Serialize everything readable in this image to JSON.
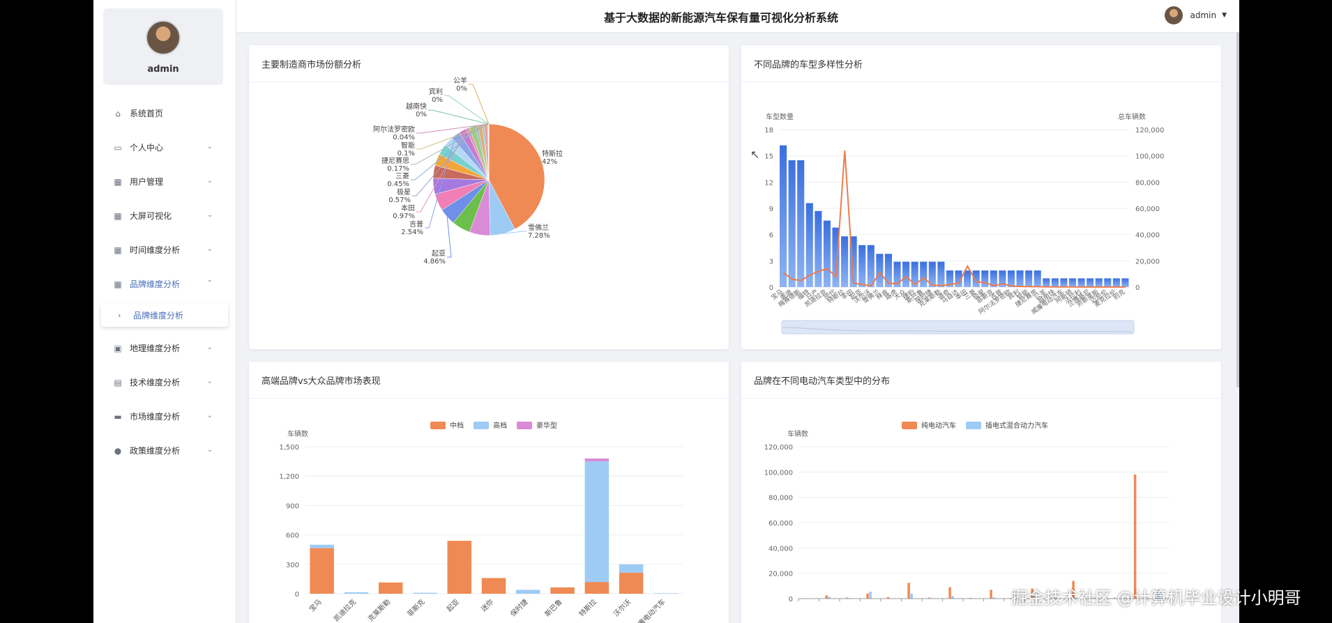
{
  "sidebar": {
    "username": "admin",
    "items": [
      {
        "label": "系统首页",
        "icon": "home-icon"
      },
      {
        "label": "个人中心",
        "icon": "id-card-icon"
      },
      {
        "label": "用户管理",
        "icon": "grid-icon"
      },
      {
        "label": "大屏可视化",
        "icon": "grid-icon"
      },
      {
        "label": "时间维度分析",
        "icon": "grid-icon"
      },
      {
        "label": "品牌维度分析",
        "icon": "grid-icon"
      },
      {
        "label": "地理维度分析",
        "icon": "bag-icon"
      },
      {
        "label": "技术维度分析",
        "icon": "clipboard-icon"
      },
      {
        "label": "市场维度分析",
        "icon": "monitor-icon"
      },
      {
        "label": "政策维度分析",
        "icon": "user-icon"
      }
    ],
    "active_sub": "品牌维度分析"
  },
  "header": {
    "title": "基于大数据的新能源汽车保有量可视化分析系统",
    "user": "admin"
  },
  "watermark": "掘金技术社区 @计算机毕业设计小明哥",
  "chart_data": [
    {
      "type": "pie",
      "title": "主要制造商市场份额分析",
      "slices": [
        {
          "name": "特斯拉",
          "label": "42%",
          "value": 42,
          "color": "#ef8a54"
        },
        {
          "name": "雪佛兰",
          "label": "7.28%",
          "value": 7.28,
          "color": "#9ecbf5"
        },
        {
          "name": "",
          "label": "",
          "value": 6.0,
          "color": "#d98bd6"
        },
        {
          "name": "",
          "label": "",
          "value": 5.3,
          "color": "#6bbf4a"
        },
        {
          "name": "起亚",
          "label": "4.86%",
          "value": 4.86,
          "color": "#6f8fe8"
        },
        {
          "name": "",
          "label": "",
          "value": 4.9,
          "color": "#ef7fb4"
        },
        {
          "name": "",
          "label": "",
          "value": 4.6,
          "color": "#a57ae0"
        },
        {
          "name": "",
          "label": "",
          "value": 3.7,
          "color": "#c96a5e"
        },
        {
          "name": "",
          "label": "",
          "value": 3.4,
          "color": "#f1a63c"
        },
        {
          "name": "",
          "label": "",
          "value": 3.1,
          "color": "#76d1d0"
        },
        {
          "name": "",
          "label": "",
          "value": 2.8,
          "color": "#b4d8f5"
        },
        {
          "name": "吉普",
          "label": "2.54%",
          "value": 2.54,
          "color": "#8aa4e8"
        },
        {
          "name": "",
          "label": "",
          "value": 2.2,
          "color": "#c67bcf"
        },
        {
          "name": "本田",
          "label": "0.97%",
          "value": 0.97,
          "color": "#e991b9"
        },
        {
          "name": "",
          "label": "",
          "value": 1.8,
          "color": "#9ad07f"
        },
        {
          "name": "极星",
          "label": "0.57%",
          "value": 0.57,
          "color": "#95a7c9"
        },
        {
          "name": "",
          "label": "",
          "value": 1.4,
          "color": "#d9b37a"
        },
        {
          "name": "三菱",
          "label": "0.45%",
          "value": 0.45,
          "color": "#7fb5d6"
        },
        {
          "name": "",
          "label": "",
          "value": 1.1,
          "color": "#e3a2a2"
        },
        {
          "name": "捷尼赛思",
          "label": "0.17%",
          "value": 0.17,
          "color": "#aab1bb"
        },
        {
          "name": "智能",
          "label": "0.1%",
          "value": 0.1,
          "color": "#cfc07a"
        },
        {
          "name": "阿尔法罗密欧",
          "label": "0.04%",
          "value": 0.04,
          "color": "#d18fb8"
        },
        {
          "name": "越南快",
          "label": "0%",
          "value": 0.01,
          "color": "#77c2a1"
        },
        {
          "name": "宾利",
          "label": "0%",
          "value": 0.01,
          "color": "#8fd0c8"
        },
        {
          "name": "公羊",
          "label": "0%",
          "value": 0.01,
          "color": "#dbb05a"
        }
      ]
    },
    {
      "type": "bar",
      "title": "不同品牌的车型多样性分析",
      "left_axis": {
        "label": "车型数量",
        "ticks": [
          "18",
          "15",
          "12",
          "9",
          "6",
          "3",
          "0"
        ],
        "max": 18
      },
      "right_axis": {
        "label": "总车辆数",
        "ticks": [
          "120,000",
          "100,000",
          "80,000",
          "60,000",
          "40,000",
          "20,000",
          "0"
        ],
        "max": 120000
      },
      "categories": [
        "宝马",
        "奥迪",
        "梅赛德斯",
        "福特",
        "日产",
        "凯迪拉克",
        "现代",
        "特斯拉",
        "丰田",
        "起亚",
        "沃尔沃",
        "雪佛兰",
        "林肯",
        "路虎",
        "大众",
        "捷豹",
        "斯巴鲁",
        "保时捷",
        "克莱斯勒",
        "道奇",
        "马自达",
        "本田",
        "三菱",
        "极星",
        "菲斯克",
        "吉普",
        "阿尔法罗密欧",
        "宾利",
        "智能",
        "捷尼赛思",
        "公羊",
        "越南快",
        "威廉电动汽车",
        "阿斯顿",
        "法拉利",
        "兰博基尼",
        "劳斯莱斯",
        "迈凯伦",
        "麦克拉伦",
        "别克"
      ],
      "series": [
        {
          "name": "车型数量",
          "values": [
            16.2,
            14.5,
            14.5,
            9.6,
            8.7,
            7.6,
            6.8,
            5.8,
            5.8,
            4.8,
            4.8,
            3.8,
            3.8,
            2.9,
            2.9,
            2.9,
            2.9,
            2.9,
            2.9,
            1.9,
            1.9,
            1.9,
            1.9,
            1.9,
            1.9,
            1.9,
            1.9,
            1.9,
            1.9,
            1.9,
            1.0,
            1.0,
            1.0,
            1.0,
            1.0,
            1.0,
            1.0,
            1.0,
            1.0,
            1.0
          ]
        },
        {
          "name": "总车辆数",
          "values": [
            11000,
            6000,
            5000,
            9000,
            12000,
            14000,
            8000,
            104000,
            3000,
            2000,
            1000,
            11000,
            3000,
            2500,
            8000,
            2000,
            7000,
            1500,
            1200,
            2000,
            3000,
            16000,
            4000,
            3500,
            1000,
            2500,
            800,
            500,
            400,
            300,
            200,
            150,
            120,
            100,
            90,
            80,
            70,
            60,
            50,
            40
          ]
        }
      ]
    },
    {
      "type": "bar",
      "title": "高端品牌vs大众品牌市场表现",
      "ylabel": "车辆数",
      "yticks": [
        "1,500",
        "1,200",
        "900",
        "600",
        "300",
        "0"
      ],
      "ymax": 1500,
      "categories": [
        "宝马",
        "凯迪拉克",
        "克莱斯勒",
        "菲斯克",
        "起亚",
        "迷你",
        "保时捷",
        "斯巴鲁",
        "特斯拉",
        "沃尔沃",
        "威廉电动汽车"
      ],
      "series": [
        {
          "name": "中档",
          "color": "#ef8a54",
          "values": [
            465,
            0,
            115,
            0,
            540,
            160,
            0,
            65,
            120,
            215,
            0
          ]
        },
        {
          "name": "高档",
          "color": "#9ecbf5",
          "values": [
            35,
            15,
            0,
            10,
            0,
            0,
            40,
            0,
            1230,
            85,
            5
          ]
        },
        {
          "name": "豪华型",
          "color": "#d98bd6",
          "values": [
            0,
            0,
            0,
            0,
            0,
            0,
            0,
            0,
            30,
            0,
            0
          ]
        }
      ]
    },
    {
      "type": "bar",
      "title": "品牌在不同电动汽车类型中的分布",
      "ylabel": "车辆数",
      "yticks": [
        "120,000",
        "100,000",
        "80,000",
        "60,000",
        "40,000",
        "20,000",
        "0"
      ],
      "ymax": 120000,
      "series": [
        {
          "name": "纯电动汽车",
          "color": "#ef8a54",
          "values": [
            300,
            2500,
            800,
            4000,
            1200,
            12500,
            800,
            9000,
            600,
            7000,
            500,
            8000,
            1500,
            14000,
            600,
            700,
            98000,
            400
          ]
        },
        {
          "name": "插电式混合动力汽车",
          "color": "#9ecbf5",
          "values": [
            200,
            1500,
            400,
            5500,
            300,
            4000,
            300,
            2000,
            200,
            1000,
            6000,
            3000,
            500,
            1000,
            200,
            300,
            300,
            7000
          ]
        }
      ]
    }
  ]
}
